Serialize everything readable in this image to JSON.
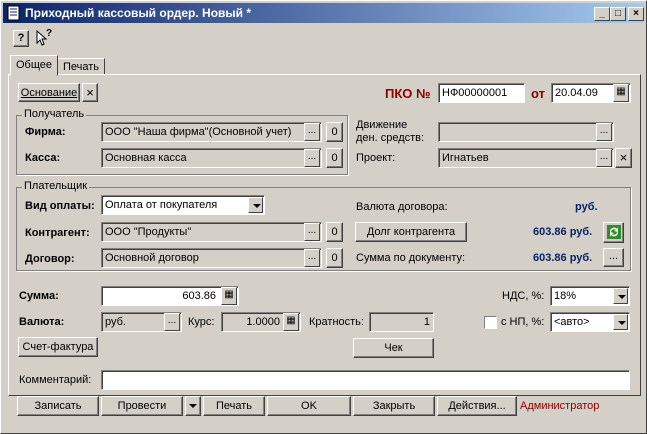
{
  "window": {
    "title": "Приходный кассовый ордер. Новый *",
    "min": "_",
    "max": "□",
    "close": "×"
  },
  "toolbar": {
    "help": "?",
    "whats_this": "?"
  },
  "tabs": [
    {
      "label": "Общее"
    },
    {
      "label": "Печать"
    }
  ],
  "basis": {
    "label": "Основание",
    "clear": "×"
  },
  "pko": {
    "label": "ПКО №",
    "number": "НФ00000001",
    "from_label": "от",
    "date": "20.04.09"
  },
  "recipient": {
    "group": "Получатель",
    "firm_label": "Фирма:",
    "firm_value": "ООО \"Наша фирма\"(Основной учет)",
    "cash_label": "Касса:",
    "cash_value": "Основная касса",
    "dots": "...",
    "open": "0"
  },
  "movement": {
    "label_line1": "Движение",
    "label_line2": "ден. средств:",
    "value": "",
    "dots": "..."
  },
  "project": {
    "label": "Проект:",
    "value": "Игнатьев",
    "dots": "...",
    "clear": "×"
  },
  "payer": {
    "group": "Плательщик",
    "paytype_label": "Вид оплаты:",
    "paytype_value": "Оплата от покупателя",
    "counterparty_label": "Контрагент:",
    "counterparty_value": "ООО \"Продукты\"",
    "contract_label": "Договор:",
    "contract_value": "Основной договор",
    "dots": "...",
    "open": "0",
    "currency_label": "Валюта договора:",
    "currency_value": "руб.",
    "debt_button": "Долг контрагента",
    "debt_value": "603.86 руб.",
    "doc_sum_label": "Сумма по документу:",
    "doc_sum_value": "603.86 руб."
  },
  "sum": {
    "label": "Сумма:",
    "value": "603.86"
  },
  "vat": {
    "label": "НДС, %:",
    "value": "18%"
  },
  "currency": {
    "label": "Валюта:",
    "value": "руб.",
    "dots": "...",
    "rate_label": "Курс:",
    "rate_value": "1.0000",
    "mult_label": "Кратность:",
    "mult_value": "1"
  },
  "sales_tax": {
    "label": "с НП, %:",
    "value": "<авто>"
  },
  "invoice_button": "Счет-фактура",
  "check_button": "Чек",
  "comment": {
    "label": "Комментарий:",
    "value": ""
  },
  "footer": {
    "save": "Записать",
    "post": "Провести",
    "print": "Печать",
    "ok": "OK",
    "close": "Закрыть",
    "actions": "Действия...",
    "user": "Администратор"
  },
  "colors": {
    "title_start": "#0a246a",
    "title_end": "#a6caf0",
    "accent_red": "#8b0000",
    "value_blue": "#0a246a"
  }
}
